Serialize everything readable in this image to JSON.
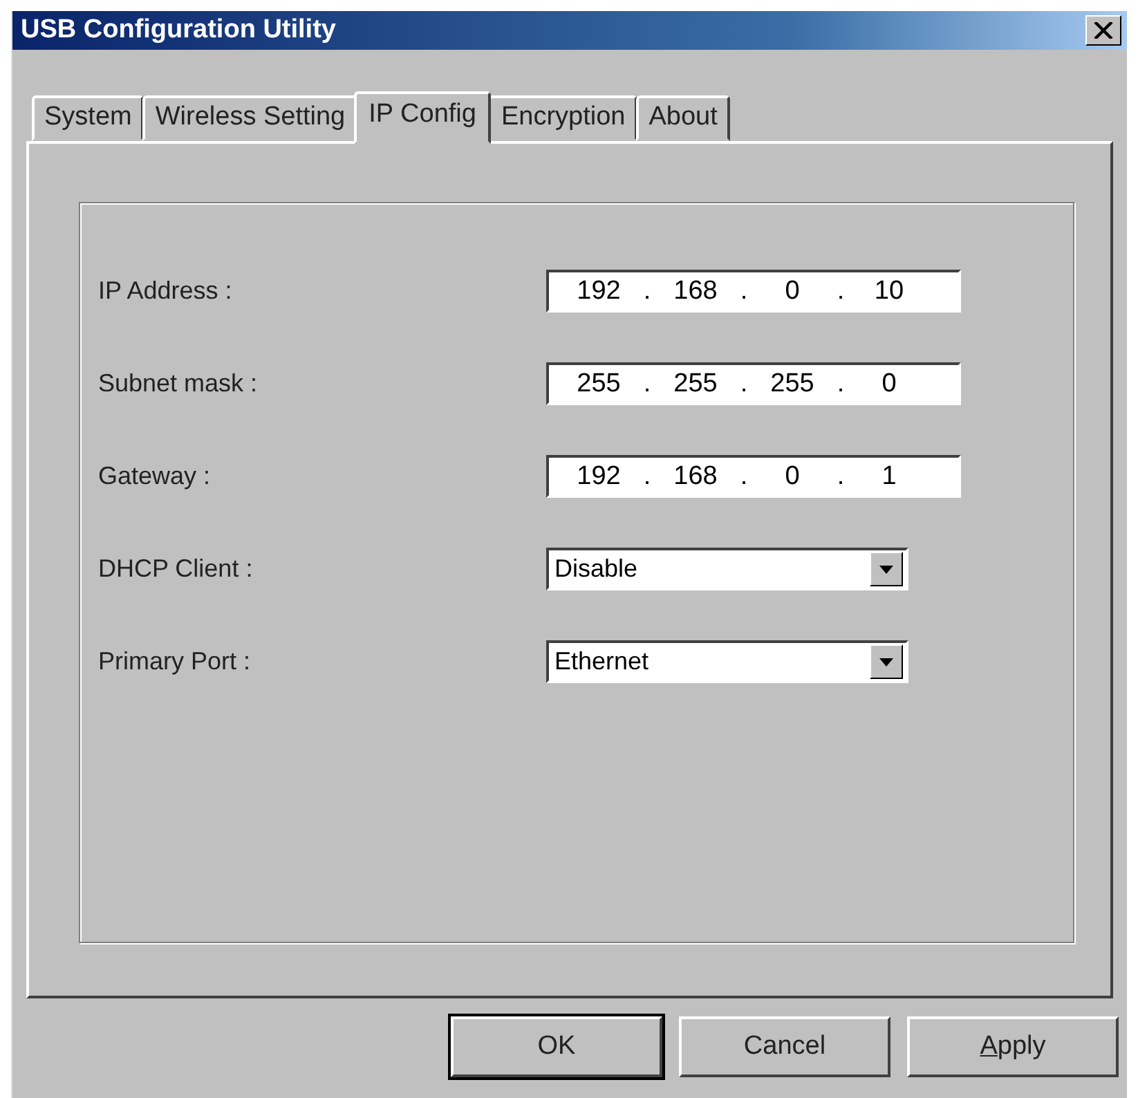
{
  "window": {
    "title": "USB Configuration Utility"
  },
  "tabs": [
    {
      "label": "System",
      "selected": false
    },
    {
      "label": "Wireless Setting",
      "selected": false
    },
    {
      "label": "IP Config",
      "selected": true
    },
    {
      "label": "Encryption",
      "selected": false
    },
    {
      "label": "About",
      "selected": false
    }
  ],
  "fields": [
    {
      "kind": "ip",
      "label": "IP Address :",
      "parts": [
        "192",
        ".",
        "168",
        ".",
        "0",
        ".",
        "10"
      ]
    },
    {
      "kind": "ip",
      "label": "Subnet mask :",
      "parts": [
        "255",
        ".",
        "255",
        ".",
        "255",
        ".",
        "0"
      ]
    },
    {
      "kind": "ip",
      "label": "Gateway :",
      "parts": [
        "192",
        ".",
        "168",
        ".",
        "0",
        ".",
        "1"
      ]
    },
    {
      "kind": "dropdown",
      "label": "DHCP Client :",
      "value": "Disable"
    },
    {
      "kind": "dropdown",
      "label": "Primary Port :",
      "value": "Ethernet"
    }
  ],
  "buttons": [
    {
      "label": "OK",
      "default": true,
      "mnemonic": false
    },
    {
      "label": "Cancel",
      "default": false,
      "mnemonic": false
    },
    {
      "label": "Apply",
      "default": false,
      "mnemonic": true
    }
  ]
}
